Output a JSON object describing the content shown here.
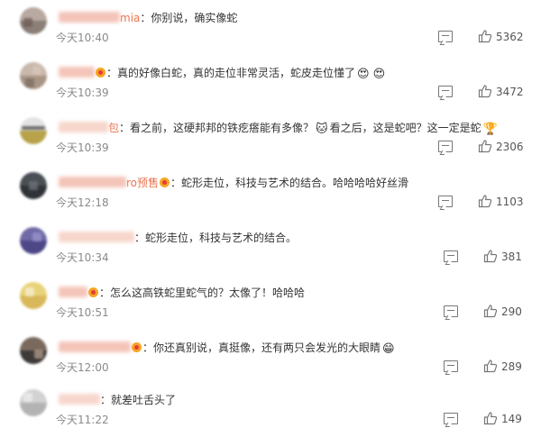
{
  "comments": [
    {
      "name_visible": "mia",
      "colon": "：",
      "text": "你别说，确实像蛇",
      "time": "今天10:40",
      "likes": "5362",
      "emoji": "",
      "emoji2": "",
      "text2": "",
      "text3": ""
    },
    {
      "name_visible": "",
      "colon": "：",
      "text": "真的好像白蛇，真的走位非常灵活，蛇皮走位懂了",
      "time": "今天10:39",
      "likes": "3472",
      "emoji": "😍",
      "emoji2": "😍",
      "text2": "",
      "text3": ""
    },
    {
      "name_visible": "包",
      "colon": "：",
      "text": "看之前，这硬邦邦的铁疙瘩能有多像？",
      "time": "今天10:39",
      "likes": "2306",
      "emoji": "🐱",
      "text2": "看之后，这是蛇吧？这一定是蛇",
      "emoji2": "🏆",
      "text3": ""
    },
    {
      "name_visible": "ro预售",
      "colon": "：",
      "text": "蛇形走位，科技与艺术的结合。哈哈哈哈好丝滑",
      "time": "今天12:18",
      "likes": "1103",
      "emoji": "",
      "emoji2": "",
      "text2": "",
      "text3": ""
    },
    {
      "name_visible": "",
      "colon": "：",
      "text": "蛇形走位，科技与艺术的结合。",
      "time": "今天10:34",
      "likes": "381",
      "emoji": "",
      "emoji2": "",
      "text2": "",
      "text3": ""
    },
    {
      "name_visible": "",
      "colon": "：",
      "text": "怎么这高铁蛇里蛇气的？太像了！哈哈哈",
      "time": "今天10:51",
      "likes": "290",
      "emoji": "",
      "emoji2": "",
      "text2": "",
      "text3": ""
    },
    {
      "name_visible": "",
      "colon": "：",
      "text": "你还真别说，真挺像，还有两只会发光的大眼睛",
      "time": "今天12:00",
      "likes": "289",
      "emoji": "😁",
      "emoji2": "",
      "text2": "",
      "text3": ""
    },
    {
      "name_visible": "",
      "colon": "：",
      "text": "就差吐舌头了",
      "time": "今天11:22",
      "likes": "149",
      "emoji": "",
      "emoji2": "",
      "text2": "",
      "text3": ""
    }
  ],
  "icons": {
    "reply": "comment-icon",
    "like": "thumbs-up-icon",
    "vip": "vip-badge-icon"
  },
  "colors": {
    "username": "#eb7350",
    "time": "#8a8a8a",
    "text": "#333333"
  }
}
